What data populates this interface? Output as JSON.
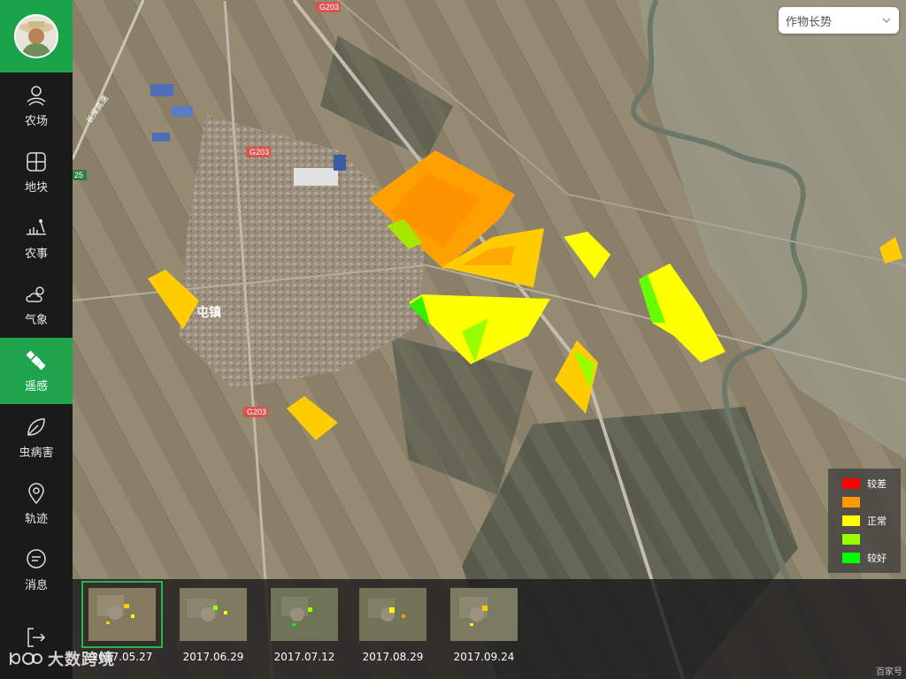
{
  "app": {
    "nav": [
      {
        "id": "farm",
        "label": "农场",
        "icon": "farm-icon"
      },
      {
        "id": "plot",
        "label": "地块",
        "icon": "plot-grid-icon"
      },
      {
        "id": "farming",
        "label": "农事",
        "icon": "farming-icon"
      },
      {
        "id": "weather",
        "label": "气象",
        "icon": "weather-cloud-sun-icon"
      },
      {
        "id": "remote",
        "label": "遥感",
        "icon": "satellite-icon",
        "active": true
      },
      {
        "id": "pest",
        "label": "虫病害",
        "icon": "leaf-pest-icon"
      },
      {
        "id": "track",
        "label": "轨迹",
        "icon": "location-pin-icon"
      },
      {
        "id": "message",
        "label": "消息",
        "icon": "message-bubble-icon"
      }
    ]
  },
  "dropdown": {
    "selected": "作物长势"
  },
  "map": {
    "road_labels": [
      "G203",
      "G203",
      "G203",
      "25",
      "长深高速"
    ],
    "town_label": "屯镇"
  },
  "legend": [
    {
      "label": "较差",
      "color": "#ff0000"
    },
    {
      "label": "",
      "color": "#ff9900"
    },
    {
      "label": "正常",
      "color": "#ffff00"
    },
    {
      "label": "",
      "color": "#99ff00"
    },
    {
      "label": "较好",
      "color": "#00ff00"
    }
  ],
  "timeline": [
    {
      "date": "2017.05.27",
      "active": true
    },
    {
      "date": "2017.06.29",
      "active": false
    },
    {
      "date": "2017.07.12",
      "active": false
    },
    {
      "date": "2017.08.29",
      "active": false
    },
    {
      "date": "2017.09.24",
      "active": false
    }
  ],
  "watermark": {
    "text": "大数跨境",
    "corner": "百家号"
  }
}
